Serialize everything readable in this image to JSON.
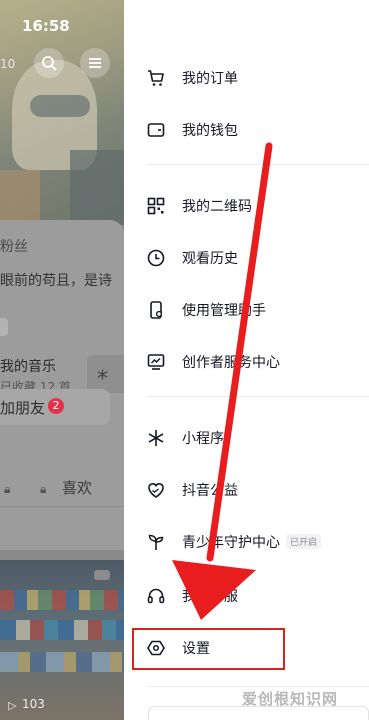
{
  "status_bar": {
    "time": "16:58",
    "partial_number": "10"
  },
  "profile": {
    "fans_label": "粉丝",
    "bio": "眼前的苟且，是诗",
    "music_title": "我的音乐",
    "music_sub": "已收藏 12 首",
    "add_friend_label": "加朋友",
    "add_friend_badge": "2",
    "tab_likes": "喜欢",
    "video_count": "103"
  },
  "drawer": {
    "items": [
      {
        "label": "我的订单",
        "icon": "cart-icon"
      },
      {
        "label": "我的钱包",
        "icon": "wallet-icon"
      },
      {
        "label": "我的二维码",
        "icon": "qr-code-icon"
      },
      {
        "label": "观看历史",
        "icon": "clock-icon"
      },
      {
        "label": "使用管理助手",
        "icon": "phone-manage-icon"
      },
      {
        "label": "创作者服务中心",
        "icon": "chart-monitor-icon"
      },
      {
        "label": "小程序",
        "icon": "asterisk-icon"
      },
      {
        "label": "抖音公益",
        "icon": "charity-heart-icon"
      },
      {
        "label": "青少年守护中心",
        "icon": "sprout-icon",
        "tag": "已开启"
      },
      {
        "label": "我的客服",
        "icon": "headset-icon"
      },
      {
        "label": "设置",
        "icon": "settings-hexagon-icon"
      }
    ]
  },
  "annotation": {
    "arrow_color": "#e81e1e",
    "highlight_color": "#e02020"
  },
  "watermark": "爱创根知识网",
  "colors": {
    "text": "#161823",
    "muted": "#8a8b91",
    "divider": "#ececec"
  }
}
